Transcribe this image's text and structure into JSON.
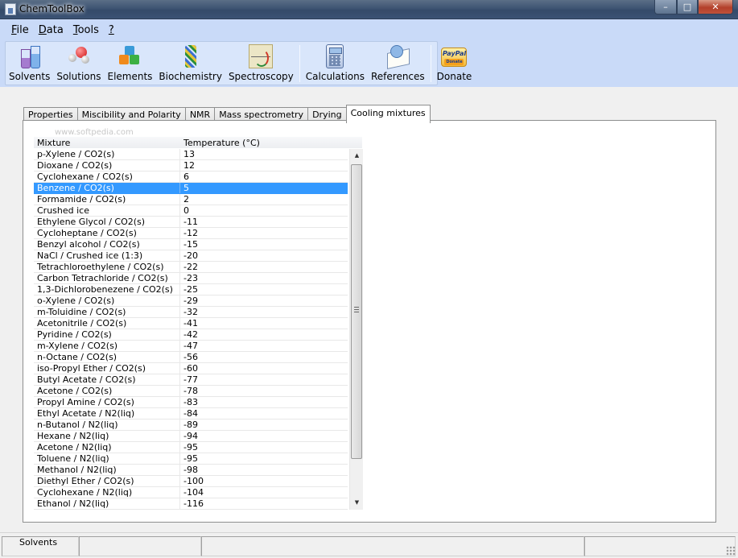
{
  "window": {
    "title": "ChemToolBox",
    "minimize_glyph": "–",
    "maximize_glyph": "□",
    "close_glyph": "✕"
  },
  "menu": [
    {
      "accel": "F",
      "rest": "ile"
    },
    {
      "accel": "D",
      "rest": "ata"
    },
    {
      "accel": "T",
      "rest": "ools"
    },
    {
      "accel": "?",
      "rest": ""
    }
  ],
  "toolbar": {
    "solvents": "Solvents",
    "solutions": "Solutions",
    "elements": "Elements",
    "biochemistry": "Biochemistry",
    "spectroscopy": "Spectroscopy",
    "calculations": "Calculations",
    "references": "References",
    "donate": "Donate",
    "paypal_logo": "PayPal",
    "paypal_donate": "Donate"
  },
  "tabs": [
    "Properties",
    "Miscibility and Polarity",
    "NMR",
    "Mass spectrometry",
    "Drying",
    "Cooling mixtures"
  ],
  "active_tab": 5,
  "watermark": "www.softpedia.com",
  "table": {
    "columns": [
      "Mixture",
      "Temperature (°C)"
    ],
    "selected_row": 3,
    "rows": [
      [
        "p-Xylene / CO2(s)",
        "13"
      ],
      [
        "Dioxane / CO2(s)",
        "12"
      ],
      [
        "Cyclohexane / CO2(s)",
        "6"
      ],
      [
        "Benzene / CO2(s)",
        "5"
      ],
      [
        "Formamide / CO2(s)",
        "2"
      ],
      [
        "Crushed ice",
        "0"
      ],
      [
        "Ethylene Glycol / CO2(s)",
        "-11"
      ],
      [
        "Cycloheptane / CO2(s)",
        "-12"
      ],
      [
        "Benzyl alcohol / CO2(s)",
        "-15"
      ],
      [
        "NaCl / Crushed ice (1:3)",
        "-20"
      ],
      [
        "Tetrachloroethylene / CO2(s)",
        "-22"
      ],
      [
        "Carbon Tetrachloride / CO2(s)",
        "-23"
      ],
      [
        "1,3-Dichlorobenezene / CO2(s)",
        "-25"
      ],
      [
        "o-Xylene / CO2(s)",
        "-29"
      ],
      [
        "m-Toluidine / CO2(s)",
        "-32"
      ],
      [
        "Acetonitrile / CO2(s)",
        "-41"
      ],
      [
        "Pyridine / CO2(s)",
        "-42"
      ],
      [
        "m-Xylene / CO2(s)",
        "-47"
      ],
      [
        "n-Octane / CO2(s)",
        "-56"
      ],
      [
        "iso-Propyl Ether / CO2(s)",
        "-60"
      ],
      [
        "Butyl Acetate / CO2(s)",
        "-77"
      ],
      [
        "Acetone / CO2(s)",
        "-78"
      ],
      [
        "Propyl Amine / CO2(s)",
        "-83"
      ],
      [
        "Ethyl Acetate / N2(liq)",
        "-84"
      ],
      [
        "n-Butanol / N2(liq)",
        "-89"
      ],
      [
        "Hexane / N2(liq)",
        "-94"
      ],
      [
        "Acetone / N2(liq)",
        "-95"
      ],
      [
        "Toluene / N2(liq)",
        "-95"
      ],
      [
        "Methanol / N2(liq)",
        "-98"
      ],
      [
        "Diethyl Ether / CO2(s)",
        "-100"
      ],
      [
        "Cyclohexane / N2(liq)",
        "-104"
      ],
      [
        "Ethanol / N2(liq)",
        "-116"
      ]
    ]
  },
  "statusbar": {
    "text": "Solvents"
  },
  "colors": {
    "selection": "#3399ff",
    "toolbar_bg": "#c9daf8"
  }
}
